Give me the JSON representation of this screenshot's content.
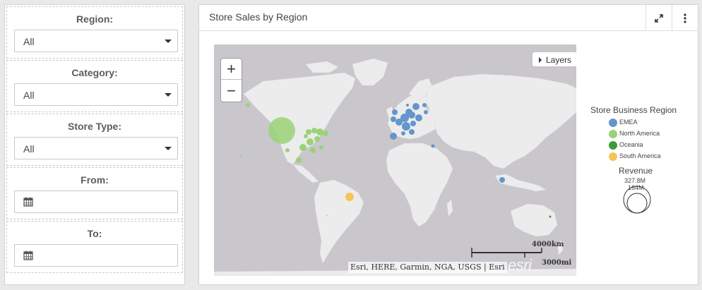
{
  "filters": [
    {
      "label": "Region:",
      "type": "select",
      "value": "All"
    },
    {
      "label": "Category:",
      "type": "select",
      "value": "All"
    },
    {
      "label": "Store Type:",
      "type": "select",
      "value": "All"
    },
    {
      "label": "From:",
      "type": "date",
      "value": ""
    },
    {
      "label": "To:",
      "type": "date",
      "value": ""
    }
  ],
  "widget": {
    "title": "Store Sales by Region",
    "expand_icon": "expand-icon",
    "menu_icon": "kebab-menu-icon"
  },
  "map": {
    "zoom_in": "+",
    "zoom_out": "−",
    "layers_label": "Layers",
    "attribution": "Esri, HERE, Garmin, NGA, USGS | Esri",
    "logo": "esri",
    "scale_km": "4000km",
    "scale_mi": "3000mi"
  },
  "legend": {
    "title": "Store Business Region",
    "items": [
      {
        "label": "EMEA",
        "color": "#6495cd"
      },
      {
        "label": "North America",
        "color": "#9bd278"
      },
      {
        "label": "Oceania",
        "color": "#3d9a3d"
      },
      {
        "label": "South America",
        "color": "#f6c458"
      }
    ],
    "size_title": "Revenue",
    "size_max": "327.8M",
    "size_min": "164M"
  },
  "colors": {
    "ocean": "#c9c6cc",
    "land": "#ececec",
    "emea": "#6495cd",
    "north_america": "#9bd278",
    "oceania": "#3d9a3d",
    "south_america": "#f6c458"
  }
}
